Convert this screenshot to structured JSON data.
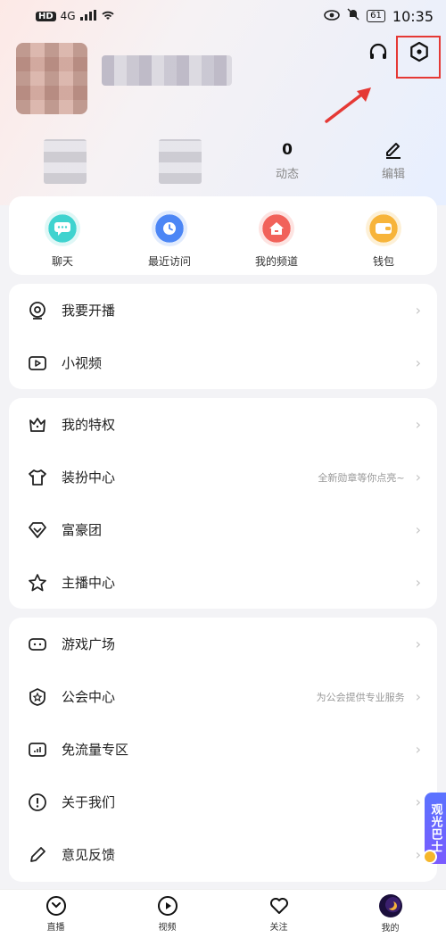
{
  "status_bar": {
    "hd": "HD",
    "network": "4G",
    "battery": "61",
    "time": "10:35"
  },
  "stats": [
    {
      "value": "",
      "label": ""
    },
    {
      "value": "",
      "label": ""
    },
    {
      "value": "0",
      "label": "动态"
    },
    {
      "value": "",
      "label": "编辑"
    }
  ],
  "quick_actions": [
    {
      "label": "聊天",
      "icon": "chat-icon",
      "color": "#3fd3cf"
    },
    {
      "label": "最近访问",
      "icon": "clock-icon",
      "color": "#4c86f5"
    },
    {
      "label": "我的频道",
      "icon": "home-icon",
      "color": "#f1625a"
    },
    {
      "label": "钱包",
      "icon": "wallet-icon",
      "color": "#f7b43a"
    }
  ],
  "menu1": [
    {
      "label": "我要开播",
      "icon": "broadcast-icon",
      "hint": ""
    },
    {
      "label": "小视频",
      "icon": "video-icon",
      "hint": ""
    }
  ],
  "menu2": [
    {
      "label": "我的特权",
      "icon": "crown-icon",
      "hint": ""
    },
    {
      "label": "装扮中心",
      "icon": "shirt-icon",
      "hint": "全新勋章等你点亮~"
    },
    {
      "label": "富豪团",
      "icon": "diamond-icon",
      "hint": ""
    },
    {
      "label": "主播中心",
      "icon": "star-icon",
      "hint": ""
    }
  ],
  "menu3": [
    {
      "label": "游戏广场",
      "icon": "gamepad-icon",
      "hint": ""
    },
    {
      "label": "公会中心",
      "icon": "guild-icon",
      "hint": "为公会提供专业服务"
    },
    {
      "label": "免流量专区",
      "icon": "data-icon",
      "hint": ""
    },
    {
      "label": "关于我们",
      "icon": "info-icon",
      "hint": ""
    },
    {
      "label": "意见反馈",
      "icon": "pencil-icon",
      "hint": ""
    }
  ],
  "side_float": {
    "label": "观光巴士"
  },
  "tabbar": [
    {
      "label": "直播",
      "icon": "live-icon"
    },
    {
      "label": "视频",
      "icon": "play-icon"
    },
    {
      "label": "关注",
      "icon": "heart-icon"
    },
    {
      "label": "我的",
      "icon": "profile-avatar-icon"
    }
  ],
  "colors": {
    "highlight": "#e53935",
    "chevron": "#c4c4c4",
    "accent_purple": "#6b63ff"
  }
}
